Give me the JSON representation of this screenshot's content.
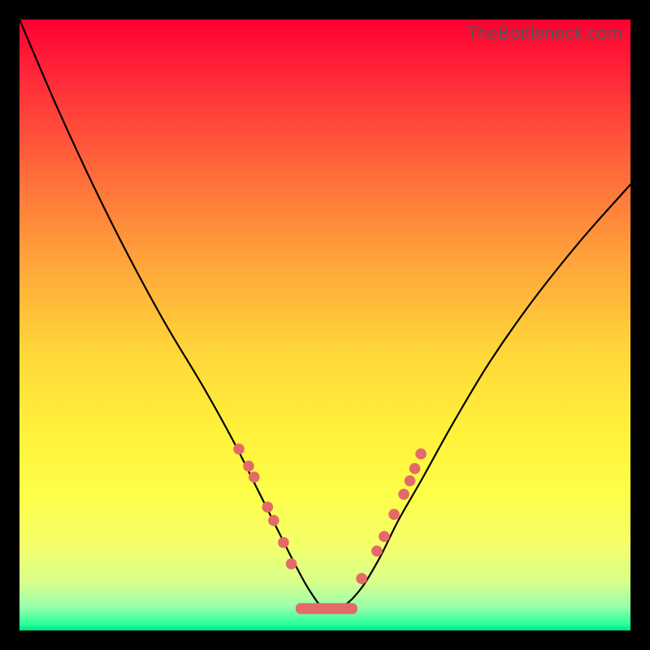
{
  "watermark": "TheBottleneck.com",
  "colors": {
    "dot": "#e46a6a",
    "curve": "#000000",
    "frame_bg_top": "#ff0030",
    "frame_bg_bottom": "#00e08a",
    "page_bg": "#000000",
    "watermark": "#555555"
  },
  "chart_data": {
    "type": "line",
    "title": "",
    "xlabel": "",
    "ylabel": "",
    "xlim": [
      0,
      100
    ],
    "ylim": [
      0,
      100
    ],
    "note": "No numeric axes or labels are visible. x/y are normalized 0–100 fractions of the 752×752 plot area; y is measured from the top.",
    "series": [
      {
        "name": "curve",
        "x": [
          0,
          6,
          12,
          18,
          24,
          30,
          35,
          39,
          42,
          45,
          47.5,
          50,
          53,
          56,
          59,
          62,
          66,
          71,
          77,
          84,
          92,
          100
        ],
        "y": [
          0,
          14,
          27,
          39,
          50,
          60,
          69,
          77,
          83,
          89,
          93.5,
          96.5,
          96,
          93,
          88,
          82,
          75,
          66,
          56,
          46,
          36,
          27
        ]
      }
    ],
    "points_left": [
      {
        "x": 35.9,
        "y": 70.3
      },
      {
        "x": 37.5,
        "y": 73.1
      },
      {
        "x": 38.4,
        "y": 74.9
      },
      {
        "x": 40.6,
        "y": 79.8
      },
      {
        "x": 41.6,
        "y": 82.0
      },
      {
        "x": 43.2,
        "y": 85.6
      },
      {
        "x": 44.5,
        "y": 89.1
      }
    ],
    "points_right": [
      {
        "x": 56.0,
        "y": 91.5
      },
      {
        "x": 58.5,
        "y": 87.0
      },
      {
        "x": 59.7,
        "y": 84.6
      },
      {
        "x": 61.3,
        "y": 81.0
      },
      {
        "x": 62.9,
        "y": 77.7
      },
      {
        "x": 63.9,
        "y": 75.5
      },
      {
        "x": 64.7,
        "y": 73.5
      },
      {
        "x": 65.7,
        "y": 71.1
      }
    ],
    "bottom_blob": {
      "x_start": 45.2,
      "x_end": 55.3,
      "y": 96.4
    },
    "dot_radius_pct": 0.9
  }
}
